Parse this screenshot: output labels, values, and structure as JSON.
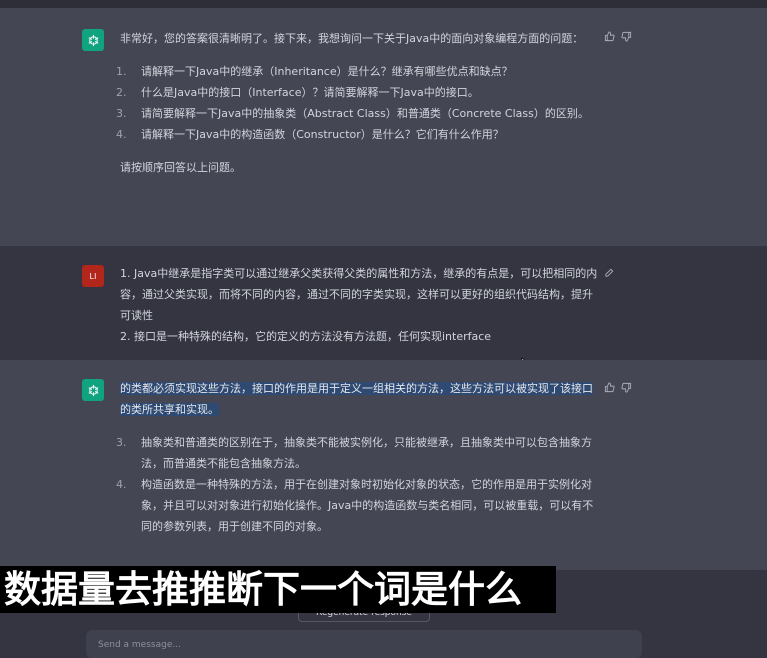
{
  "colors": {
    "assistant_bg": "#444654",
    "user_bg": "#343541",
    "gpt_avatar": "#10a37f",
    "user_avatar": "#b2261c",
    "highlight": "#2f4a72"
  },
  "messages": {
    "m1": {
      "intro": "非常好，您的答案很清晰明了。接下来，我想询问一下关于Java中的面向对象编程方面的问题：",
      "items": [
        {
          "num": "1.",
          "text": "请解释一下Java中的继承（Inheritance）是什么？继承有哪些优点和缺点？"
        },
        {
          "num": "2.",
          "text": "什么是Java中的接口（Interface）？请简要解释一下Java中的接口。"
        },
        {
          "num": "3.",
          "text": "请简要解释一下Java中的抽象类（Abstract Class）和普通类（Concrete Class）的区别。"
        },
        {
          "num": "4.",
          "text": "请解释一下Java中的构造函数（Constructor）是什么？它们有什么作用？"
        }
      ],
      "closing": "请按顺序回答以上问题。"
    },
    "m2": {
      "avatar_text": "LI",
      "line1": "1. Java中继承是指字类可以通过继承父类获得父类的属性和方法，继承的有点是，可以把相同的内容，通过父类实现，而将不同的内容，通过不同的字类实现，这样可以更好的组织代码结构，提升可读性",
      "line2": "2. 接口是一种特殊的结构，它的定义的方法没有方法题，任何实现interface"
    },
    "m3": {
      "highlighted": "的类都必须实现这些方法，接口的作用是用于定义一组相关的方法，这些方法可以被实现了该接口的类所共享和实现。",
      "items": [
        {
          "num": "3.",
          "text": "抽象类和普通类的区别在于，抽象类不能被实例化，只能被继承，且抽象类中可以包含抽象方法，而普通类不能包含抽象方法。"
        },
        {
          "num": "4.",
          "text": "构造函数是一种特殊的方法，用于在创建对象时初始化对象的状态，它的作用是用于实例化对象，并且可以对对象进行初始化操作。Java中的构造函数与类名相同，可以被重载，可以有不同的参数列表，用于创建不同的对象。"
        }
      ]
    }
  },
  "icons": {
    "gpt": "openai-logo-icon",
    "thumb_up": "thumbs-up-icon",
    "thumb_down": "thumbs-down-icon",
    "edit": "edit-icon"
  },
  "footer": {
    "caption": "数据量去推推断下一个词是什么",
    "regenerate": "Regenerate response",
    "send_placeholder": "Send a message..."
  }
}
